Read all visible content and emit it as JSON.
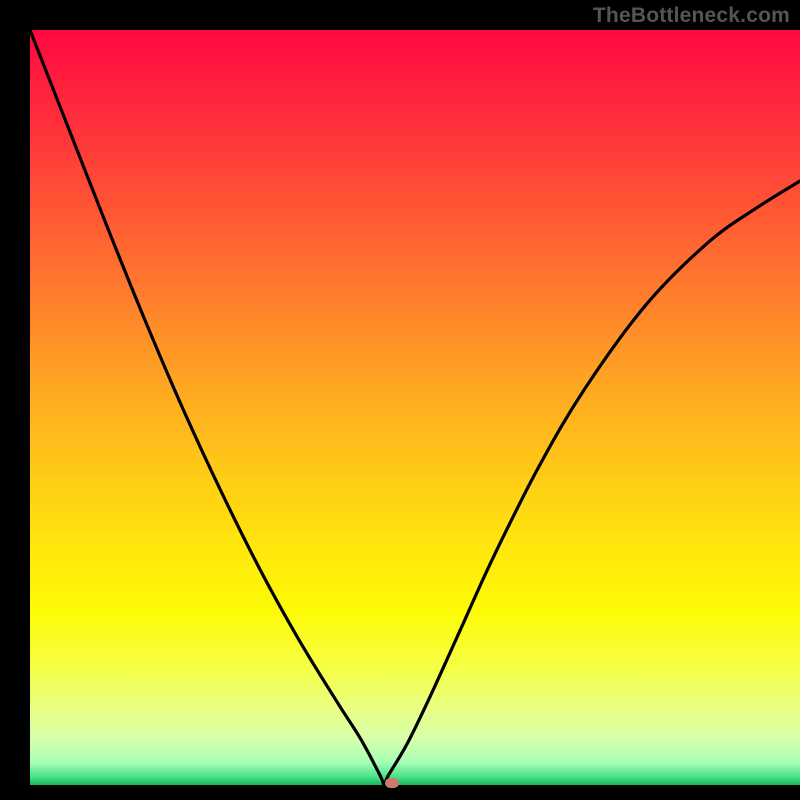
{
  "watermark": "TheBottleneck.com",
  "colors": {
    "frame_bg": "#000000",
    "watermark": "#555555",
    "curve_stroke": "#000000",
    "dot_fill": "#cc7a6f",
    "gradient_stops": [
      {
        "pos": 0.0,
        "hex": "#ff0840"
      },
      {
        "pos": 0.06,
        "hex": "#ff1b3e"
      },
      {
        "pos": 0.15,
        "hex": "#ff383a"
      },
      {
        "pos": 0.25,
        "hex": "#ff5a33"
      },
      {
        "pos": 0.35,
        "hex": "#ff7d2d"
      },
      {
        "pos": 0.46,
        "hex": "#ffa323"
      },
      {
        "pos": 0.57,
        "hex": "#ffc518"
      },
      {
        "pos": 0.68,
        "hex": "#ffe50d"
      },
      {
        "pos": 0.77,
        "hex": "#fdfb06"
      },
      {
        "pos": 0.84,
        "hex": "#f6ff40"
      },
      {
        "pos": 0.9,
        "hex": "#e8ff84"
      },
      {
        "pos": 0.94,
        "hex": "#d6ffaa"
      },
      {
        "pos": 0.97,
        "hex": "#a6ffb6"
      },
      {
        "pos": 0.99,
        "hex": "#46e085"
      },
      {
        "pos": 1.0,
        "hex": "#16b85a"
      }
    ]
  },
  "chart_data": {
    "type": "line",
    "title": "",
    "xlabel": "",
    "ylabel": "",
    "x_range": [
      0,
      1
    ],
    "y_range": [
      0,
      1
    ],
    "notch_x": 0.46,
    "marker": {
      "x": 0.47,
      "y": 0.0
    },
    "series": [
      {
        "name": "bottleneck-curve",
        "x": [
          0.0,
          0.05,
          0.1,
          0.15,
          0.2,
          0.25,
          0.3,
          0.35,
          0.4,
          0.43,
          0.455,
          0.46,
          0.465,
          0.49,
          0.52,
          0.56,
          0.6,
          0.66,
          0.72,
          0.8,
          0.88,
          0.94,
          1.0
        ],
        "y": [
          1.0,
          0.87,
          0.74,
          0.614,
          0.495,
          0.385,
          0.283,
          0.191,
          0.108,
          0.06,
          0.012,
          0.0,
          0.012,
          0.055,
          0.118,
          0.208,
          0.298,
          0.42,
          0.524,
          0.636,
          0.718,
          0.762,
          0.8
        ]
      }
    ]
  }
}
